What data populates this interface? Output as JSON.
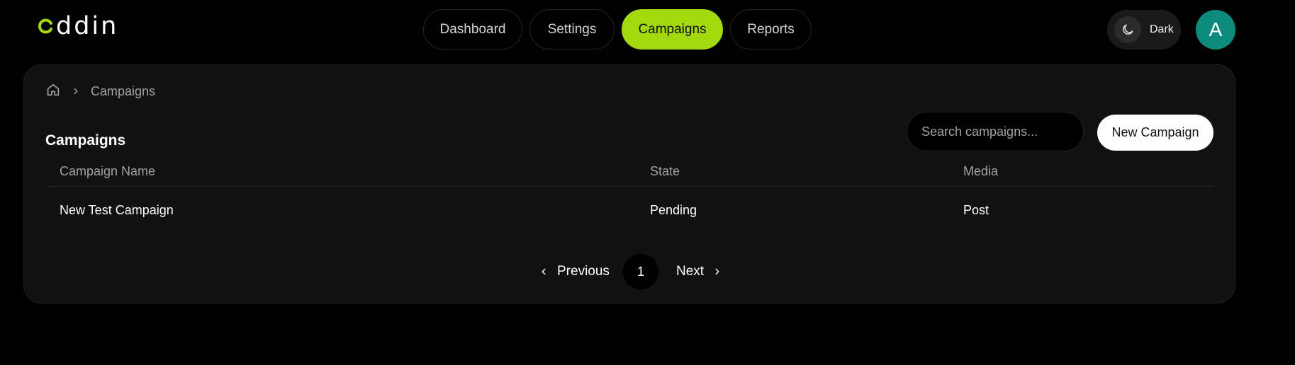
{
  "brand": {
    "logo_text": "ddin",
    "accent": "#a3d90f"
  },
  "nav": {
    "tabs": [
      {
        "label": "Dashboard",
        "active": false
      },
      {
        "label": "Settings",
        "active": false
      },
      {
        "label": "Campaigns",
        "active": true
      },
      {
        "label": "Reports",
        "active": false
      }
    ]
  },
  "theme": {
    "label": "Dark",
    "icon": "moon-icon"
  },
  "user": {
    "avatar_initial": "A",
    "avatar_color": "#0e8a7c"
  },
  "breadcrumb": {
    "home_icon": "home-icon",
    "current": "Campaigns"
  },
  "page": {
    "title": "Campaigns"
  },
  "search": {
    "placeholder": "Search campaigns...",
    "value": ""
  },
  "actions": {
    "new_label": "New Campaign"
  },
  "table": {
    "columns": [
      "Campaign Name",
      "State",
      "Media"
    ],
    "rows": [
      [
        "New Test Campaign",
        "Pending",
        "Post"
      ]
    ]
  },
  "pagination": {
    "prev_label": "Previous",
    "current_page": "1",
    "next_label": "Next"
  }
}
